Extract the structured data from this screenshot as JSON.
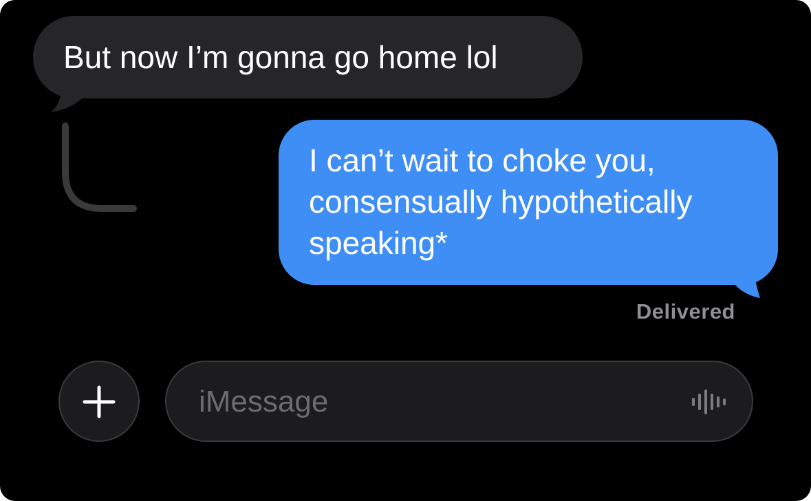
{
  "messages": {
    "incoming": {
      "text": "But now I’m gonna go home lol"
    },
    "outgoing": {
      "lines": [
        "I can’t wait to choke you,",
        "consensually hypothetically",
        "speaking*"
      ]
    },
    "status": "Delivered"
  },
  "compose": {
    "add_icon": "plus-icon",
    "placeholder": "iMessage",
    "audio_icon": "waveform-icon"
  },
  "colors": {
    "background": "#000000",
    "incoming_bubble": "#262628",
    "outgoing_bubble": "#3f8ef5",
    "secondary_text": "#8e8e93"
  }
}
